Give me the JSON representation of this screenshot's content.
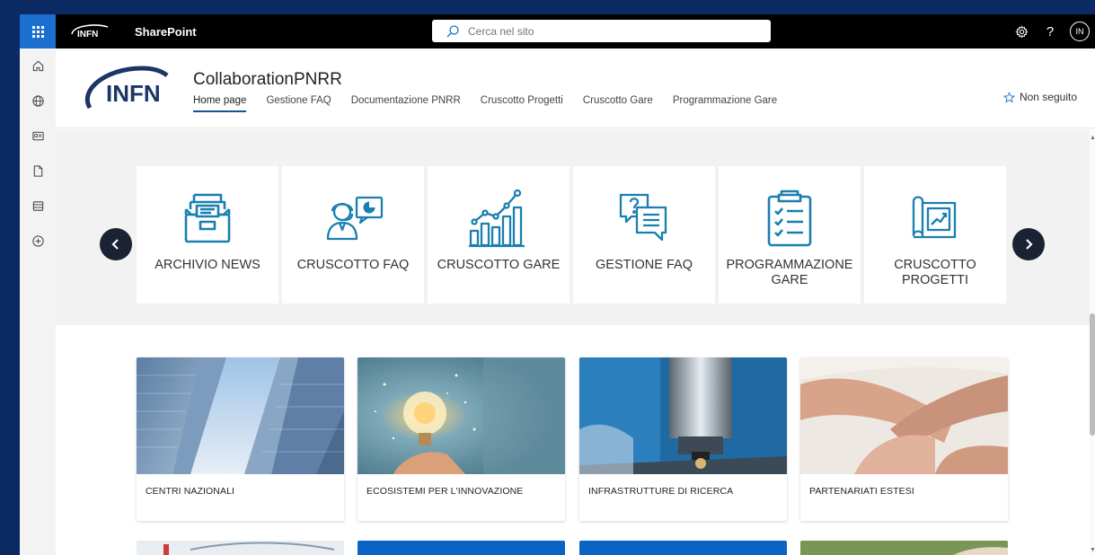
{
  "suite": {
    "app_name": "SharePoint",
    "logo_text": "INFN",
    "search_placeholder": "Cerca nel sito",
    "avatar_initials": "IN",
    "help_label": "?"
  },
  "site": {
    "logo_text": "INFN",
    "title": "CollaborationPNRR",
    "follow_label": "Non seguito",
    "nav": [
      {
        "label": "Home page",
        "active": true
      },
      {
        "label": "Gestione FAQ",
        "active": false
      },
      {
        "label": "Documentazione PNRR",
        "active": false
      },
      {
        "label": "Cruscotto Progetti",
        "active": false
      },
      {
        "label": "Cruscotto Gare",
        "active": false
      },
      {
        "label": "Programmazione Gare",
        "active": false
      }
    ]
  },
  "quick_links": [
    {
      "label": "ARCHIVIO NEWS",
      "icon": "archive-drawer-icon"
    },
    {
      "label": "CRUSCOTTO FAQ",
      "icon": "support-agent-icon"
    },
    {
      "label": "CRUSCOTTO GARE",
      "icon": "bar-chart-growth-icon"
    },
    {
      "label": "GESTIONE FAQ",
      "icon": "question-chat-icon"
    },
    {
      "label": "PROGRAMMAZIONE GARE",
      "icon": "checklist-clipboard-icon"
    },
    {
      "label": "CRUSCOTTO PROGETTI",
      "icon": "blueprint-chart-icon"
    }
  ],
  "tiles": [
    {
      "label": "CENTRI NAZIONALI",
      "image": "skyscrapers-photo"
    },
    {
      "label": "ECOSISTEMI PER L'INNOVAZIONE",
      "image": "lightbulb-photo"
    },
    {
      "label": "INFRASTRUTTURE DI RICERCA",
      "image": "microscope-photo"
    },
    {
      "label": "PARTENARIATI ESTESI",
      "image": "joined-arms-photo"
    }
  ],
  "colors": {
    "accent": "#1a6fd1",
    "icon_blue": "#1a7fb0",
    "suite_bar": "#000000",
    "outer_frame": "#0b2a63",
    "nav_arrow": "#1b2233"
  }
}
